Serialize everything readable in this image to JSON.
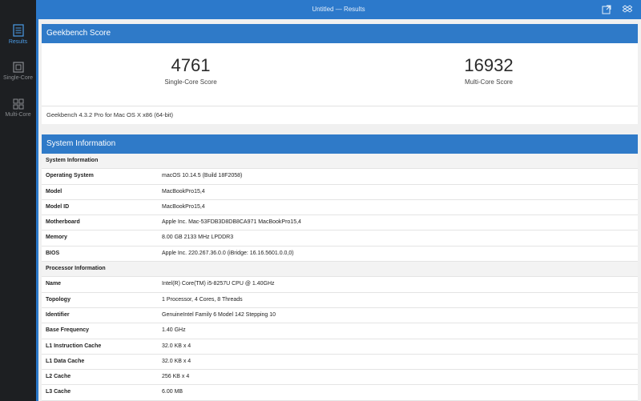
{
  "sidebar": {
    "items": [
      {
        "label": "Results",
        "icon": "results-icon",
        "active": true
      },
      {
        "label": "Single-Core",
        "icon": "single-core-icon",
        "active": false
      },
      {
        "label": "Multi-Core",
        "icon": "multi-core-icon",
        "active": false
      }
    ]
  },
  "window": {
    "title": "Untitled — Results",
    "icons": [
      "export-icon",
      "dropbox-icon"
    ]
  },
  "geekbench": {
    "header": "Geekbench Score",
    "single": {
      "value": "4761",
      "label": "Single-Core Score"
    },
    "multi": {
      "value": "16932",
      "label": "Multi-Core Score"
    },
    "version": "Geekbench 4.3.2 Pro for Mac OS X x86 (64-bit)"
  },
  "sysinfo": {
    "header": "System Information",
    "rows": [
      {
        "section": "System Information"
      },
      {
        "key": "Operating System",
        "value": "macOS 10.14.5 (Build 18F2058)"
      },
      {
        "key": "Model",
        "value": "MacBookPro15,4"
      },
      {
        "key": "Model ID",
        "value": "MacBookPro15,4"
      },
      {
        "key": "Motherboard",
        "value": "Apple Inc. Mac-53FDB3D8DB8CA971 MacBookPro15,4"
      },
      {
        "key": "Memory",
        "value": "8.00 GB 2133 MHz LPDDR3"
      },
      {
        "key": "BIOS",
        "value": "Apple Inc. 220.267.36.0.0 (iBridge: 16.16.5601.0.0,0)"
      },
      {
        "section": "Processor Information"
      },
      {
        "key": "Name",
        "value": "Intel(R) Core(TM) i5-8257U CPU @ 1.40GHz"
      },
      {
        "key": "Topology",
        "value": "1 Processor, 4 Cores, 8 Threads"
      },
      {
        "key": "Identifier",
        "value": "GenuineIntel Family 6 Model 142 Stepping 10"
      },
      {
        "key": "Base Frequency",
        "value": "1.40 GHz"
      },
      {
        "key": "L1 Instruction Cache",
        "value": "32.0 KB x 4"
      },
      {
        "key": "L1 Data Cache",
        "value": "32.0 KB x 4"
      },
      {
        "key": "L2 Cache",
        "value": "256 KB x 4"
      },
      {
        "key": "L3 Cache",
        "value": "6.00 MB"
      }
    ]
  },
  "colors": {
    "accent": "#2f7ac8",
    "sidebar": "#1d1f22",
    "active": "#4a9be6"
  }
}
